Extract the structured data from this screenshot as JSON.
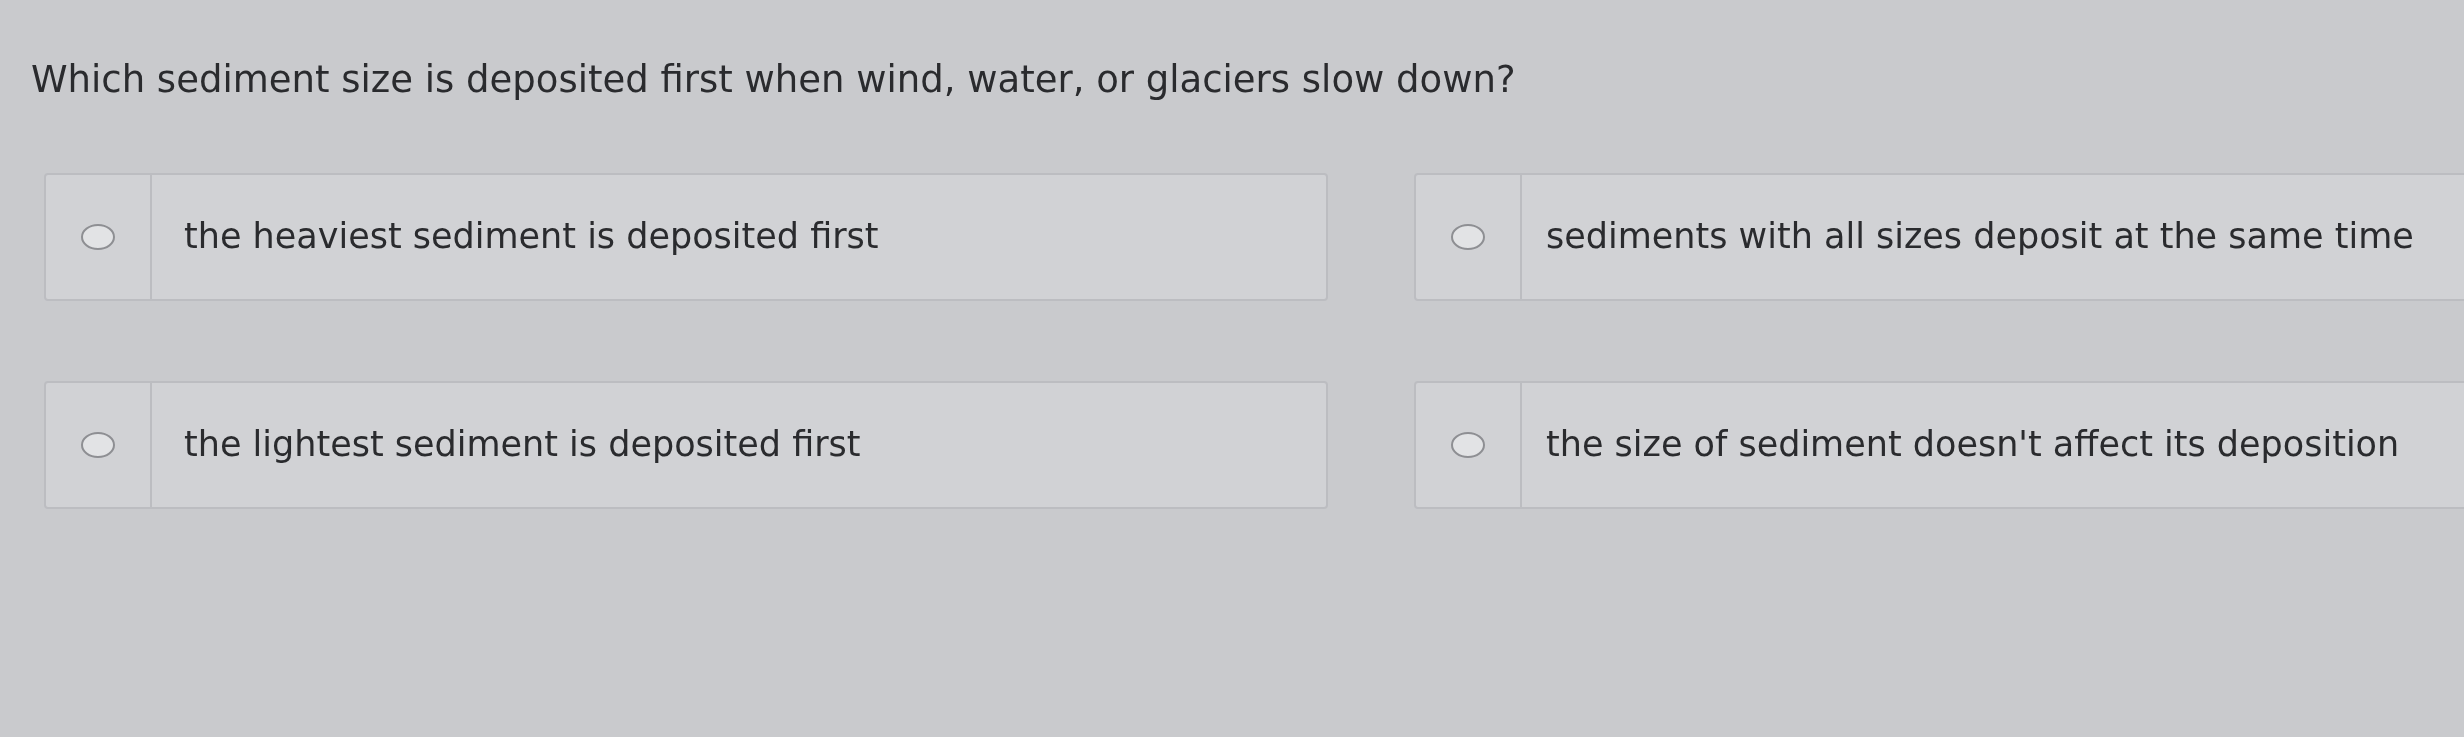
{
  "question": "Which sediment size is deposited first when wind, water, or glaciers slow down?",
  "options": [
    {
      "label": "the heaviest sediment is deposited first",
      "selected": false
    },
    {
      "label": "sediments with all sizes deposit at the same time",
      "selected": false
    },
    {
      "label": "the lightest sediment is deposited first",
      "selected": false
    },
    {
      "label": "the size of sediment doesn't affect its deposition",
      "selected": false
    }
  ]
}
